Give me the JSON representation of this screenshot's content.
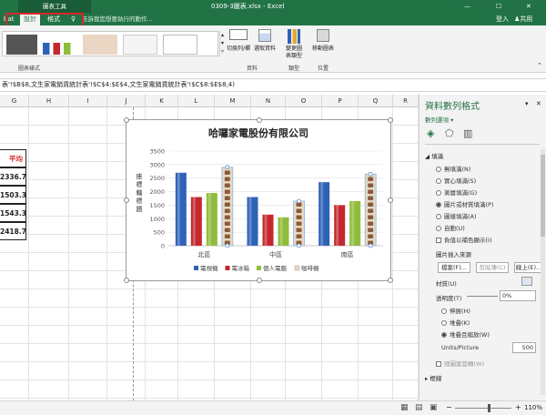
{
  "window": {
    "chart_tools": "圖表工具",
    "title": "0309-3圖表.xlsx - Excel",
    "min": "—",
    "restore": "☐",
    "close": "✕"
  },
  "tabs": {
    "partial": "bat",
    "design": "設計",
    "format": "格式",
    "tell_me": "告訴我您想要執行的動作...",
    "sign_in": "登入",
    "share": "共用"
  },
  "ribbon": {
    "group_chart_styles": "圖表樣式",
    "switch_row_col": "切換列/欄",
    "select_data": "選取資料",
    "group_data": "資料",
    "change_chart_type": "變更圖表類型",
    "group_type": "類型",
    "move_chart": "移動圖表",
    "group_location": "位置"
  },
  "formula_bar": {
    "text": "表'!$B$8,文生家電銷貨統計表'!$C$4:$E$4,文生家電銷貨統計表'!$C$8:$E$8,4)"
  },
  "columns": [
    "G",
    "H",
    "I",
    "J",
    "K",
    "L",
    "M",
    "N",
    "O",
    "P",
    "Q",
    "R"
  ],
  "cells": {
    "header": "平均",
    "values": [
      "2336.7",
      "1503.3",
      "1543.3",
      "2418.7"
    ]
  },
  "pane": {
    "title": "資料數列格式",
    "subtitle": "數列選項 ▾",
    "close": "✕",
    "pin": "▾",
    "fill_section": "填滿",
    "fill_options": [
      {
        "label": "無填滿(N)",
        "selected": false
      },
      {
        "label": "實心填滿(S)",
        "selected": false
      },
      {
        "label": "漸層填滿(G)",
        "selected": false
      },
      {
        "label": "圖片或材質填滿(P)",
        "selected": true
      },
      {
        "label": "圖樣填滿(A)",
        "selected": false
      },
      {
        "label": "自動(U)",
        "selected": false
      }
    ],
    "invert": "負值以補色顯示(I)",
    "picture_source": "圖片插入來源",
    "file_btn": "檔案(F)...",
    "clipboard_btn": "剪貼簿(C)",
    "online_btn": "線上(E)...",
    "texture": "材質(U)",
    "transparency": "透明度(T)",
    "transparency_value": "0%",
    "layout_options": [
      {
        "label": "伸展(H)",
        "selected": false
      },
      {
        "label": "堆疊(K)",
        "selected": false
      },
      {
        "label": "堆疊且縮放(W)",
        "selected": true
      }
    ],
    "units_label": "Units/Picture",
    "units_value": "500",
    "rotate": "隨圖案旋轉(W)",
    "border_section": "框線"
  },
  "statusbar": {
    "zoom": "110%"
  },
  "colors": {
    "excel_green": "#217346",
    "tv": "#2e62b8",
    "fridge": "#c4282d",
    "pc": "#8fbc3c",
    "coffee": "#e6d8c4"
  },
  "chart_data": {
    "type": "bar",
    "title": "哈囉家電股份有限公司",
    "ylabel": "座標軸標題",
    "categories": [
      "北區",
      "中區",
      "南區"
    ],
    "ylim": [
      0,
      3500
    ],
    "yticks": [
      0,
      500,
      1000,
      1500,
      2000,
      2500,
      3000,
      3500
    ],
    "series": [
      {
        "name": "電視機",
        "values": [
          2700,
          1800,
          2350
        ]
      },
      {
        "name": "電冰箱",
        "values": [
          1800,
          1150,
          1500
        ]
      },
      {
        "name": "個人電腦",
        "values": [
          1950,
          1050,
          1650
        ]
      },
      {
        "name": "咖啡機",
        "values": [
          2900,
          1650,
          2650
        ]
      }
    ],
    "legend": "bottom"
  }
}
